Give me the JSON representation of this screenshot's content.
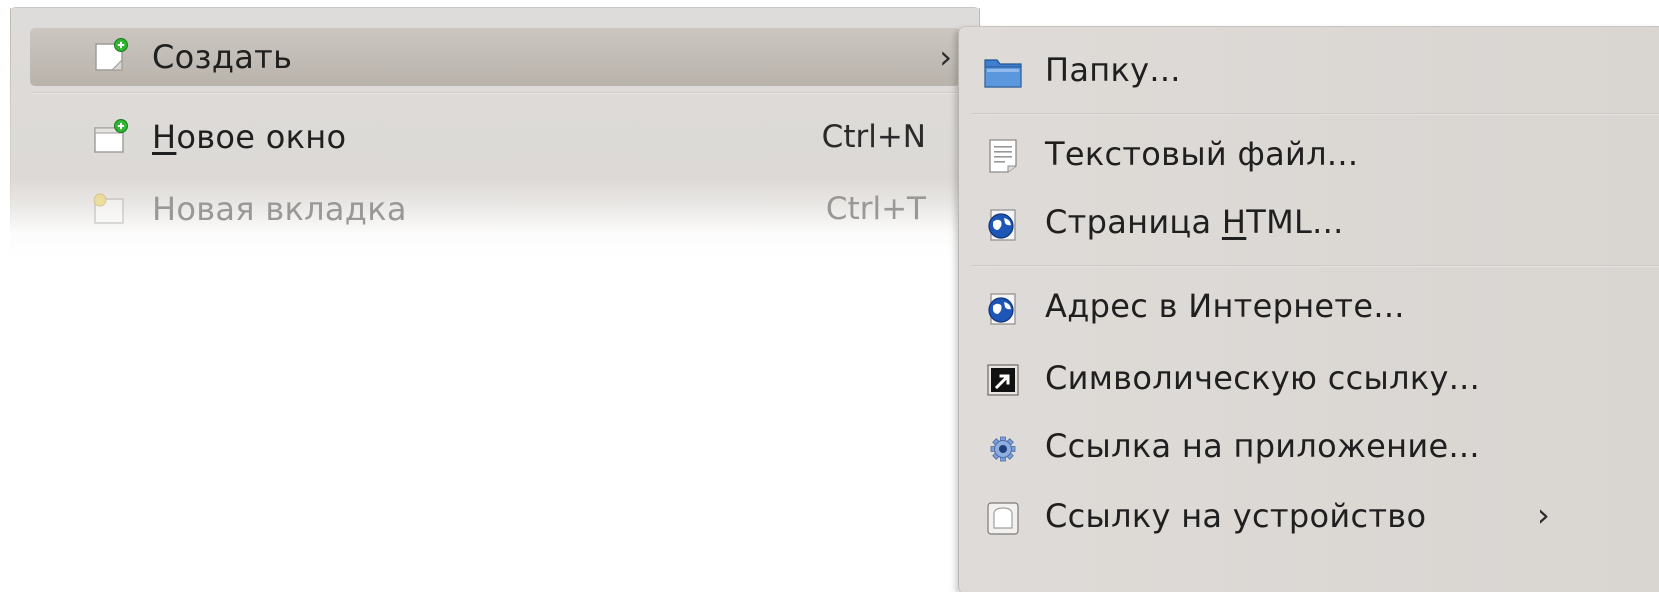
{
  "main_menu": {
    "items": [
      {
        "label": "Создать",
        "shortcut": "",
        "arrow": "›",
        "icon": "new-document-icon",
        "state": "highlighted"
      },
      {
        "label_accel": "Н",
        "label_rest": "овое окно",
        "shortcut": "Ctrl+N",
        "icon": "new-window-icon",
        "state": "normal"
      },
      {
        "label": "Новая вкладка",
        "shortcut": "Ctrl+T",
        "icon": "new-tab-icon",
        "state": "faded"
      }
    ]
  },
  "submenu": {
    "items": [
      {
        "label": "Папку...",
        "icon": "folder-icon"
      },
      {
        "label": "Текстовый файл...",
        "icon": "text-file-icon"
      },
      {
        "label_pre": "Страница ",
        "label_accel": "H",
        "label_rest": "TML...",
        "icon": "html-globe-icon"
      },
      {
        "label": "Адрес в Интернете...",
        "icon": "globe-icon"
      },
      {
        "label": "Символическую ссылку...",
        "icon": "symlink-icon"
      },
      {
        "label": "Ссылка на приложение...",
        "icon": "application-gear-icon"
      },
      {
        "label": "Ссылку на устройство",
        "arrow": "›",
        "icon": "device-icon"
      }
    ]
  },
  "colors": {
    "menu_bg": "#dcd9d6",
    "highlight": "#bfb9b2",
    "text": "#1f1f1f",
    "faded_text": "#9a9896",
    "folder_blue": "#3f7fcf",
    "globe_blue": "#1e56b8",
    "plus_green": "#2fb52f"
  }
}
